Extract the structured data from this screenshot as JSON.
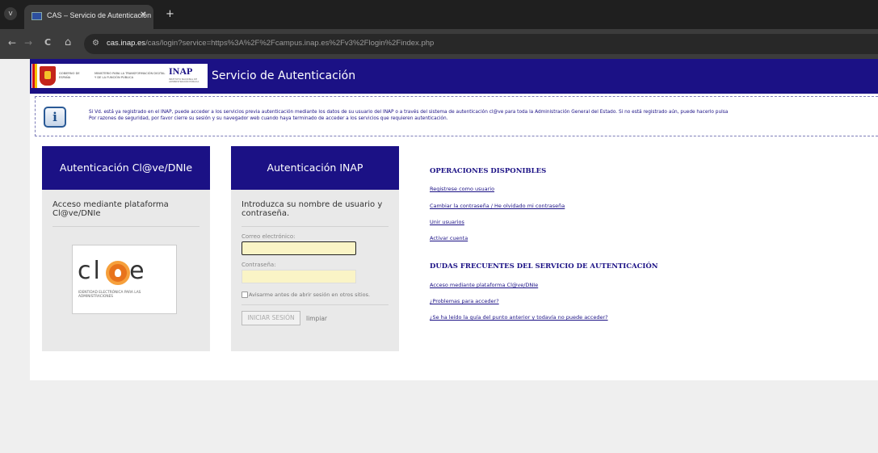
{
  "browser": {
    "tab_title": "CAS – Servicio de Autenticación",
    "tab_close": "✕",
    "new_tab": "+",
    "url_host": "cas.inap.es",
    "url_rest": "/cas/login?service=https%3A%2F%2Fcampus.inap.es%2Fv3%2Flogin%2Findex.php",
    "back": "←",
    "forward": "→",
    "reload": "C",
    "home": "⌂",
    "menu": "v"
  },
  "header": {
    "logo_gov": "GOBIERNO DE ESPAÑA",
    "logo_ministry": "MINISTERIO PARA LA TRANSFORMACIÓN DIGITAL Y DE LA FUNCIÓN PÚBLICA",
    "logo_inap": "INAP",
    "logo_inap_sub": "INSTITUTO NACIONAL DE ADMINISTRACIÓN PÚBLICA",
    "title": "Servicio de Autenticación"
  },
  "info": {
    "line1": "Si Vd. está ya registrado en el INAP, puede acceder a los servicios previa autenticación mediante los datos de su usuario del INAP o a través del sistema de autenticación cl@ve para toda la Administración General del Estado. Si no está registrado aún, puede hacerlo pulsa",
    "line2": "Por razones de seguridad, por favor cierre su sesión y su navegador web cuando haya terminado de acceder a los servicios que requieren autenticación."
  },
  "clave_panel": {
    "title": "Autenticación Cl@ve/DNIe",
    "text": "Acceso mediante plataforma Cl@ve/DNIe",
    "logo_word": "cl ve",
    "logo_sub": "IDENTIDAD ELECTRÓNICA PARA LAS ADMINISTRACIONES"
  },
  "inap_panel": {
    "title": "Autenticación INAP",
    "intro": "Introduzca su nombre de usuario y contraseña.",
    "email_label": "Correo electrónico:",
    "email_value": "",
    "password_label": "Contraseña:",
    "password_value": "",
    "remember_label": "Avisarme antes de abrir sesión en otros sitios.",
    "login_button": "INICIAR SESIÓN",
    "clear_button": "limpiar"
  },
  "operations": {
    "title": "OPERACIONES DISPONIBLES",
    "links": [
      "Registrese como usuario",
      "Cambiar la contraseña / He olvidado mi contraseña",
      "Unir usuarios",
      "Activar cuenta"
    ],
    "faq_title": "DUDAS FRECUENTES DEL SERVICIO DE AUTENTICACIÓN",
    "faq_links": [
      "Acceso mediante plataforma Cl@ve/DNIe",
      "¿Problemas para acceder?",
      "¿Se ha leído la guía del punto anterior y todavía no puede acceder?"
    ]
  },
  "colors": {
    "brand": "#1b1185",
    "field_bg": "#faf4c6"
  }
}
